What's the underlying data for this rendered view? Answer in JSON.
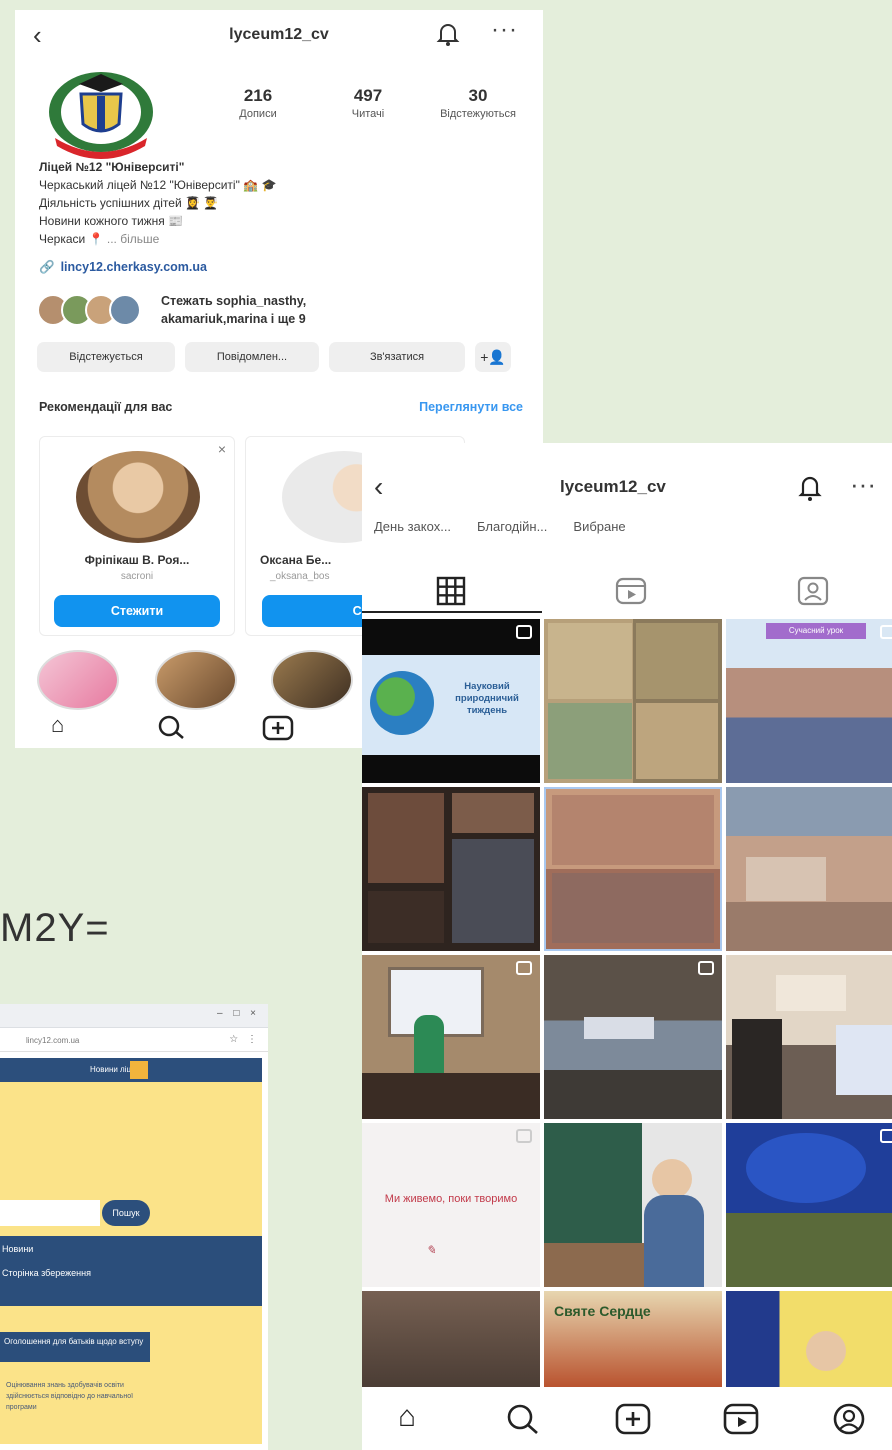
{
  "profile": {
    "username": "lyceum12_cv",
    "stats": [
      {
        "num": "216",
        "label": "Дописи"
      },
      {
        "num": "497",
        "label": "Читачі"
      },
      {
        "num": "30",
        "label": "Відстежуються"
      }
    ],
    "bio": {
      "name": "Ліцей №12 \"Юніверситі\"",
      "lines": [
        "Черкаський ліцей №12 \"Юніверситі\" 🏫 🎓",
        "Діяльність успішних дітей 👩‍🎓 👨‍🎓",
        "Новини кожного тижня 📰"
      ],
      "city": "Черкаси 📍",
      "more": "... більше"
    },
    "link": "lincy12.cherkasy.com.ua",
    "followers_text_1": "Стежать sophia_nasthy,",
    "followers_text_2": "akamariuk,marina і ще 9",
    "buttons": [
      "Відстежується",
      "Повідомлен...",
      "Зв'язатися",
      "+👤"
    ],
    "recommendations": {
      "title": "Рекомендації для вас",
      "see_all": "Переглянути все",
      "cards": [
        {
          "name": "Фріпікаш В. Роя...",
          "sub": "sacroni",
          "button": "Стежити"
        },
        {
          "name": "Оксана Бе...",
          "sub": "_oksana_bos",
          "button": "Стеж"
        }
      ]
    }
  },
  "grid_view": {
    "username": "lyceum12_cv",
    "highlights": [
      "День закох...",
      "Благодійн...",
      "Вибране"
    ],
    "cells": [
      {
        "caption": "Науковий природничий тиждень"
      },
      {
        "caption": ""
      },
      {
        "caption": "Сучасний урок"
      },
      {
        "caption": ""
      },
      {
        "caption": ""
      },
      {
        "caption": ""
      },
      {
        "caption": ""
      },
      {
        "caption": ""
      },
      {
        "caption": ""
      },
      {
        "caption": "Ми живемо, поки творимо"
      },
      {
        "caption": ""
      },
      {
        "caption": ""
      },
      {
        "caption": ""
      },
      {
        "caption": "Святе Сердце"
      },
      {
        "caption": ""
      }
    ]
  },
  "browser": {
    "url": "lincy12.com.ua",
    "header": "Новини ліцею",
    "search_button": "Пошук",
    "nav_1": "Новини",
    "nav_2": "Сторінка збереження",
    "notice": "Оголошення для батьків щодо вступу",
    "small_text": "Оцінювання знань здобувачів освіти здійснюється відповідно до навчальної програми"
  },
  "overlay_text": "M2Y="
}
